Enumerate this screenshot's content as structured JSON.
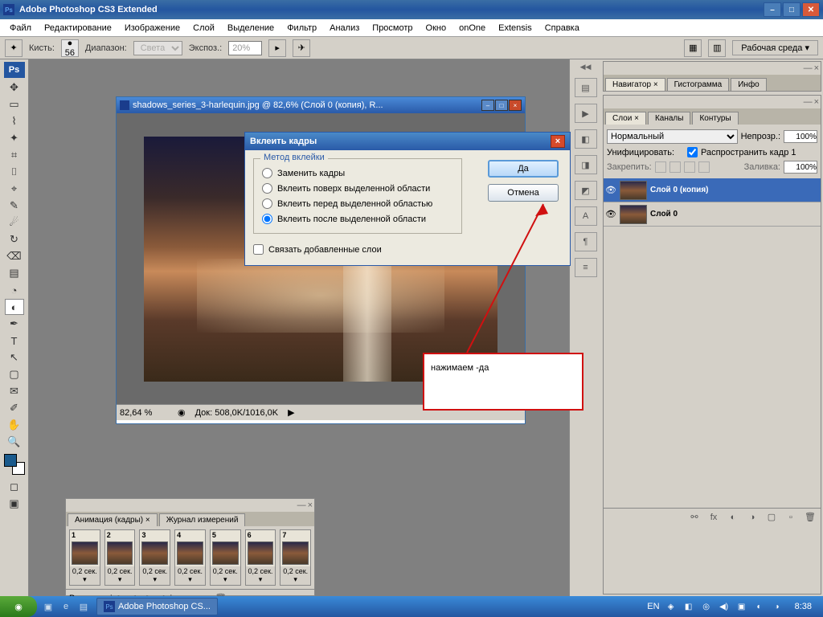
{
  "titlebar": {
    "app": "Adobe Photoshop CS3 Extended",
    "ps_badge": "Ps"
  },
  "menubar": [
    "Файл",
    "Редактирование",
    "Изображение",
    "Слой",
    "Выделение",
    "Фильтр",
    "Анализ",
    "Просмотр",
    "Окно",
    "onOne",
    "Extensis",
    "Справка"
  ],
  "optionsbar": {
    "brush_label": "Кисть:",
    "brush_size": "56",
    "range_label": "Диапазон:",
    "range_value": "Света",
    "exposure_label": "Экспоз.:",
    "exposure_value": "20%",
    "workspace": "Рабочая среда ▾"
  },
  "document": {
    "title": "shadows_series_3-harlequin.jpg @ 82,6% (Слой 0 (копия), R...",
    "zoom": "82,64 %",
    "docinfo": "Док: 508,0K/1016,0K"
  },
  "dialog": {
    "title": "Вклеить кадры",
    "group_title": "Метод вклейки",
    "radios": [
      {
        "label": "Заменить кадры",
        "checked": false
      },
      {
        "label": "Вклеить поверх выделенной области",
        "checked": false
      },
      {
        "label": "Вклеить перед выделенной областью",
        "checked": false
      },
      {
        "label": "Вклеить после выделенной области",
        "checked": true
      }
    ],
    "checkbox": {
      "label": "Связать добавленные слои",
      "checked": false
    },
    "ok": "Да",
    "cancel": "Отмена"
  },
  "annotation": {
    "text": "нажимаем -да"
  },
  "navigator_tabs": [
    "Навигатор ×",
    "Гистограмма",
    "Инфо"
  ],
  "layers_panel": {
    "tabs": [
      "Слои ×",
      "Каналы",
      "Контуры"
    ],
    "blend": "Нормальный",
    "opacity_label": "Непрозр.:",
    "opacity": "100%",
    "unify_label": "Унифицировать:",
    "propagate": "Распространить кадр 1",
    "lock_label": "Закрепить:",
    "fill_label": "Заливка:",
    "fill": "100%",
    "layers": [
      {
        "name": "Слой 0 (копия)",
        "visible": true,
        "selected": true
      },
      {
        "name": "Слой 0",
        "visible": true,
        "selected": false
      }
    ]
  },
  "animation": {
    "tabs": [
      "Анимация (кадры) ×",
      "Журнал измерений"
    ],
    "frames": [
      {
        "n": "1",
        "d": "0,2 сек. ▾"
      },
      {
        "n": "2",
        "d": "0,2 сек. ▾"
      },
      {
        "n": "3",
        "d": "0,2 сек. ▾"
      },
      {
        "n": "4",
        "d": "0,2 сек. ▾"
      },
      {
        "n": "5",
        "d": "0,2 сек. ▾"
      },
      {
        "n": "6",
        "d": "0,2 сек. ▾"
      },
      {
        "n": "7",
        "d": "0,2 сек. ▾"
      }
    ],
    "loop": "Всегда ▾"
  },
  "taskbar": {
    "app": "Adobe Photoshop CS...",
    "lang": "EN",
    "time": "8:38"
  }
}
